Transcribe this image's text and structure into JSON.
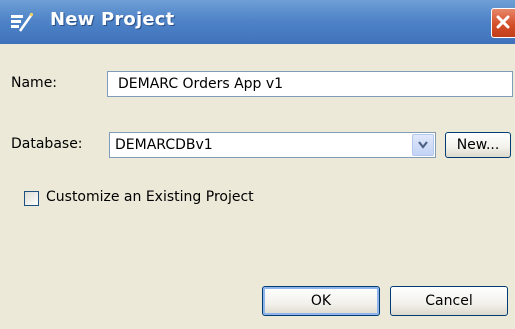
{
  "window": {
    "title": "New Project",
    "icon": "project-wizard-icon",
    "close_icon": "close-icon"
  },
  "form": {
    "name_label": "Name:",
    "name_value": "DEMARC Orders App v1",
    "database_label": "Database:",
    "database_value": "DEMARCDBv1",
    "new_button_label": "New...",
    "customize_label": "Customize an Existing Project",
    "customize_checked": false
  },
  "footer": {
    "ok_label": "OK",
    "cancel_label": "Cancel"
  },
  "colors": {
    "titlebar": "#4f84c8",
    "close_button": "#d4502b",
    "dialog_bg": "#ece9d8",
    "input_border": "#7f9db9"
  }
}
